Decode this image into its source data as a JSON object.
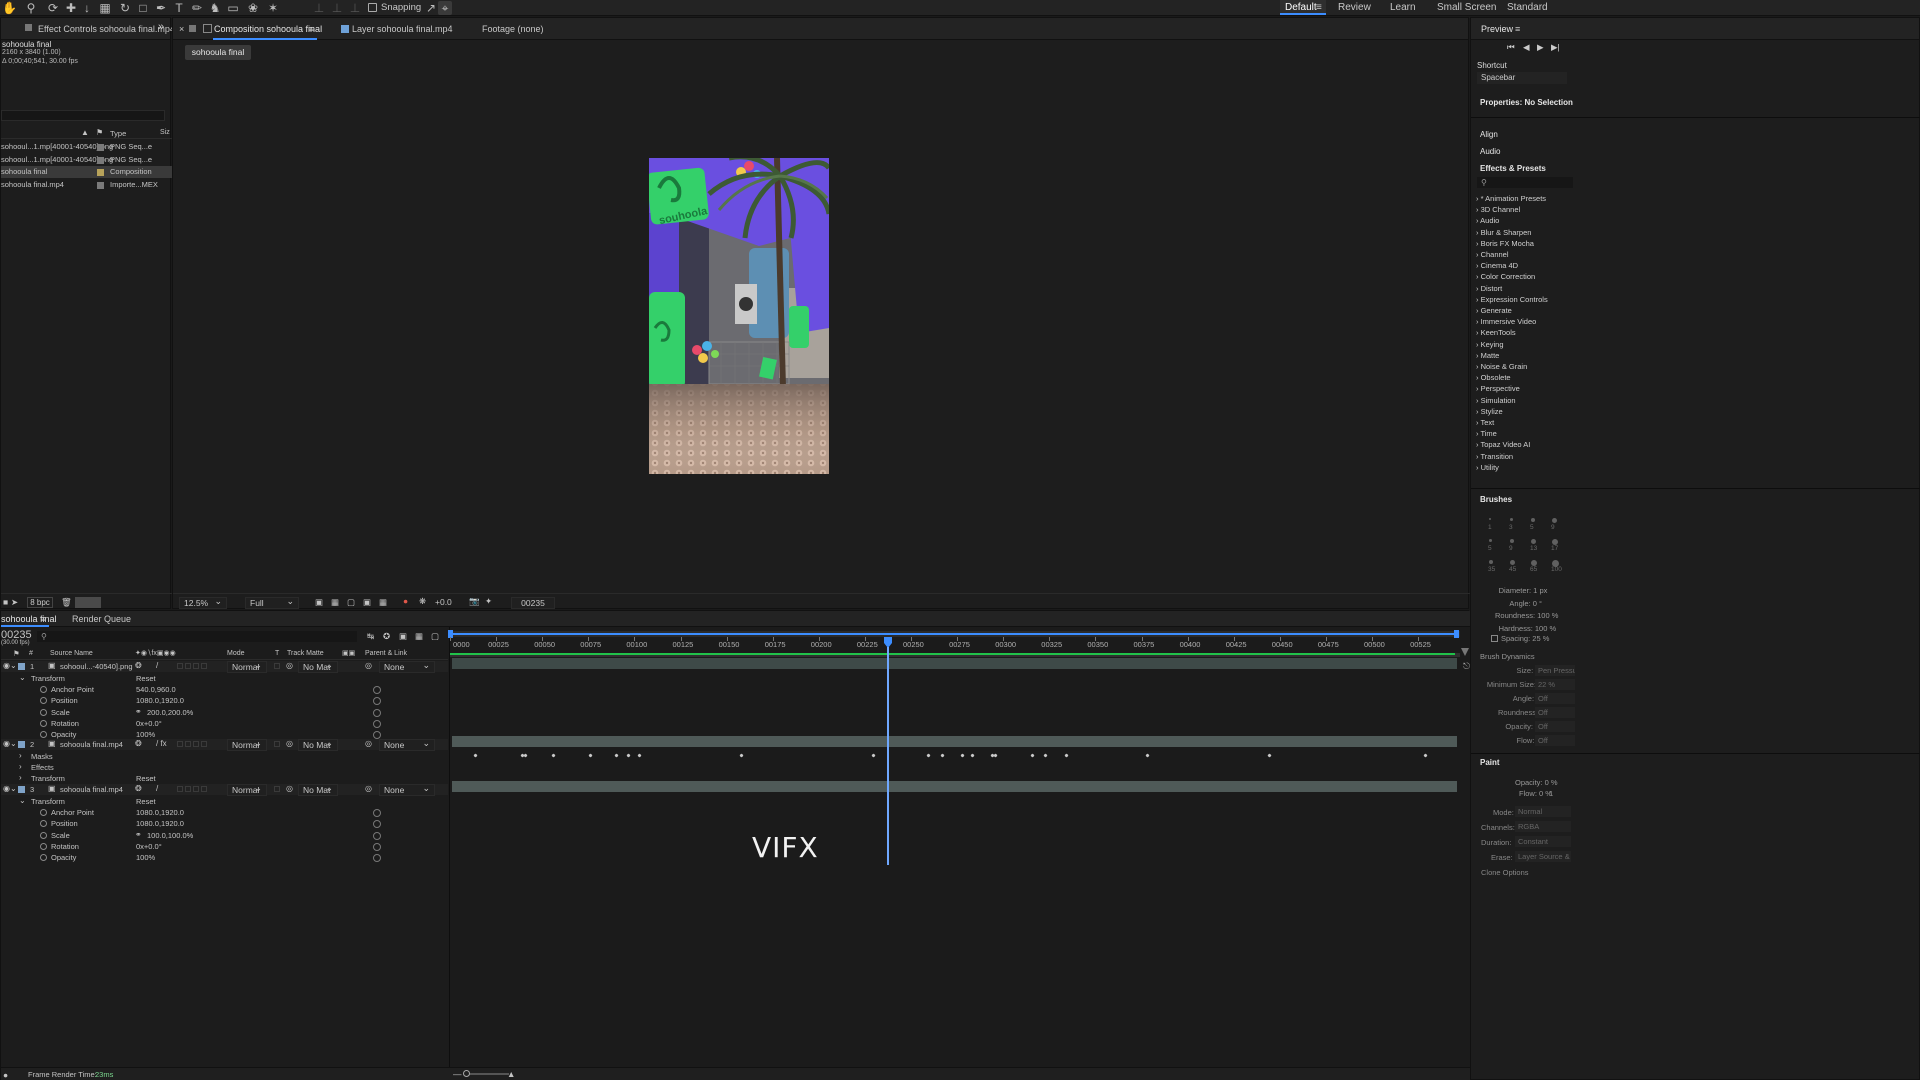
{
  "workspaces": {
    "default": "Default",
    "review": "Review",
    "learn": "Learn",
    "small_screen": "Small Screen",
    "standard": "Standard"
  },
  "toolbar": {
    "snapping": "Snapping"
  },
  "project": {
    "tab": "Effect Controls sohooula final.mp4",
    "info_name": "sohooula final",
    "info_dims": "2160 x 3840 (1.00)",
    "info_dur": "Δ 0;00;40;541, 30.00 fps",
    "col_type": "Type",
    "col_size": "Siz",
    "items": [
      {
        "name": "sohooul...1.mp[40001-40540].png",
        "type": "PNG Seq...e"
      },
      {
        "name": "sohooul...1.mp[40001-40540].png",
        "type": "PNG Seq...e"
      },
      {
        "name": "sohooula final",
        "type": "Composition"
      },
      {
        "name": "sohooula final.mp4",
        "type": "Importe...MEX"
      }
    ],
    "bpc": "8 bpc"
  },
  "viewer": {
    "comp_tab": "Composition sohooula final",
    "layer_tab": "Layer sohooula final.mp4",
    "footage_tab": "Footage (none)",
    "comp_chip": "sohooula final",
    "zoom": "12.5%",
    "resolution": "Full",
    "exposure": "+0.0",
    "timecode": "00235"
  },
  "timeline": {
    "tab": "sohooula final",
    "render_queue": "Render Queue",
    "current_time": "00235",
    "fps": "(30.00 fps)",
    "headers": {
      "source": "Source Name",
      "mode": "Mode",
      "t": "T",
      "track_matte": "Track Matte",
      "parent": "Parent & Link"
    },
    "ruler": [
      "0000",
      "00025",
      "00050",
      "00075",
      "00100",
      "00125",
      "00150",
      "00175",
      "00200",
      "00225",
      "00250",
      "00275",
      "00300",
      "00325",
      "00350",
      "00375",
      "00400",
      "00425",
      "00450",
      "00475",
      "00500",
      "00525"
    ],
    "layers": [
      {
        "num": "1",
        "name": "sohooul...-40540].png",
        "mode": "Normal",
        "matte": "No Mat",
        "parent": "None",
        "transform": "Transform",
        "reset": "Reset",
        "props": [
          {
            "name": "Anchor Point",
            "value": "540.0,960.0"
          },
          {
            "name": "Position",
            "value": "1080.0,1920.0"
          },
          {
            "name": "Scale",
            "value": "200.0,200.0%"
          },
          {
            "name": "Rotation",
            "value": "0x+0.0°"
          },
          {
            "name": "Opacity",
            "value": "100%"
          }
        ]
      },
      {
        "num": "2",
        "name": "sohooula final.mp4",
        "mode": "Normal",
        "matte": "No Mat",
        "parent": "None",
        "masks": "Masks",
        "effects": "Effects",
        "transform": "Transform",
        "reset": "Reset",
        "keyframes": [
          8,
          59,
          62,
          92,
          131,
          159,
          171,
          183,
          292,
          432,
          490,
          505,
          527,
          537,
          558,
          562,
          601,
          615,
          637,
          723,
          853,
          1019
        ]
      },
      {
        "num": "3",
        "name": "sohooula final.mp4",
        "mode": "Normal",
        "matte": "No Mat",
        "parent": "None",
        "transform": "Transform",
        "reset": "Reset",
        "props": [
          {
            "name": "Anchor Point",
            "value": "1080.0,1920.0"
          },
          {
            "name": "Position",
            "value": "1080.0,1920.0"
          },
          {
            "name": "Scale",
            "value": "100.0,100.0%"
          },
          {
            "name": "Rotation",
            "value": "0x+0.0°"
          },
          {
            "name": "Opacity",
            "value": "100%"
          }
        ]
      }
    ],
    "frame_render_label": "Frame Render Time:",
    "frame_render_value": "23ms"
  },
  "watermark": "VIFX",
  "right_panel": {
    "preview": "Preview",
    "shortcut_label": "Shortcut",
    "shortcut_value": "Spacebar",
    "properties": "Properties: No Selection",
    "align": "Align",
    "audio": "Audio",
    "effects_presets": "Effects & Presets",
    "search_placeholder": "",
    "effects": [
      "* Animation Presets",
      "3D Channel",
      "Audio",
      "Blur & Sharpen",
      "Boris FX Mocha",
      "Channel",
      "Cinema 4D",
      "Color Correction",
      "Distort",
      "Expression Controls",
      "Generate",
      "Immersive Video",
      "KeenTools",
      "Keying",
      "Matte",
      "Noise & Grain",
      "Obsolete",
      "Perspective",
      "Simulation",
      "Stylize",
      "Text",
      "Time",
      "Topaz Video AI",
      "Transition",
      "Utility"
    ],
    "brushes": "Brushes",
    "brush_sizes": [
      "1",
      "3",
      "5",
      "9",
      "5",
      "9",
      "13",
      "17",
      "35",
      "45",
      "65",
      "100"
    ],
    "brush_props": [
      {
        "label": "Diameter:",
        "value": "1 px"
      },
      {
        "label": "Angle:",
        "value": "0 °"
      },
      {
        "label": "Roundness:",
        "value": "100 %"
      },
      {
        "label": "Hardness:",
        "value": "100 %"
      }
    ],
    "spacing": "Spacing: 25 %",
    "brush_dynamics": "Brush Dynamics",
    "dyn": [
      {
        "label": "Size:",
        "value": "Pen Pressure"
      },
      {
        "label": "Minimum Size:",
        "value": "22 %"
      },
      {
        "label": "Angle:",
        "value": "Off"
      },
      {
        "label": "Roundness:",
        "value": "Off"
      },
      {
        "label": "Opacity:",
        "value": "Off"
      },
      {
        "label": "Flow:",
        "value": "Off"
      }
    ],
    "paint": "Paint",
    "paint_opacity": "Opacity: 0 %",
    "paint_flow": "Flow: 0 %",
    "paint_mode_label": "Mode:",
    "paint_mode": "Normal",
    "paint_channels_label": "Channels:",
    "paint_channels": "RGBA",
    "paint_duration_label": "Duration:",
    "paint_duration": "Constant",
    "paint_erase_label": "Erase:",
    "paint_erase": "Layer Source & Paint",
    "clone_options": "Clone Options"
  },
  "colors": {
    "accent_blue": "#3c8dff",
    "bar_green": "#21c24a",
    "brand_purple": "#6a4fe0",
    "brand_green": "#34d06a"
  }
}
